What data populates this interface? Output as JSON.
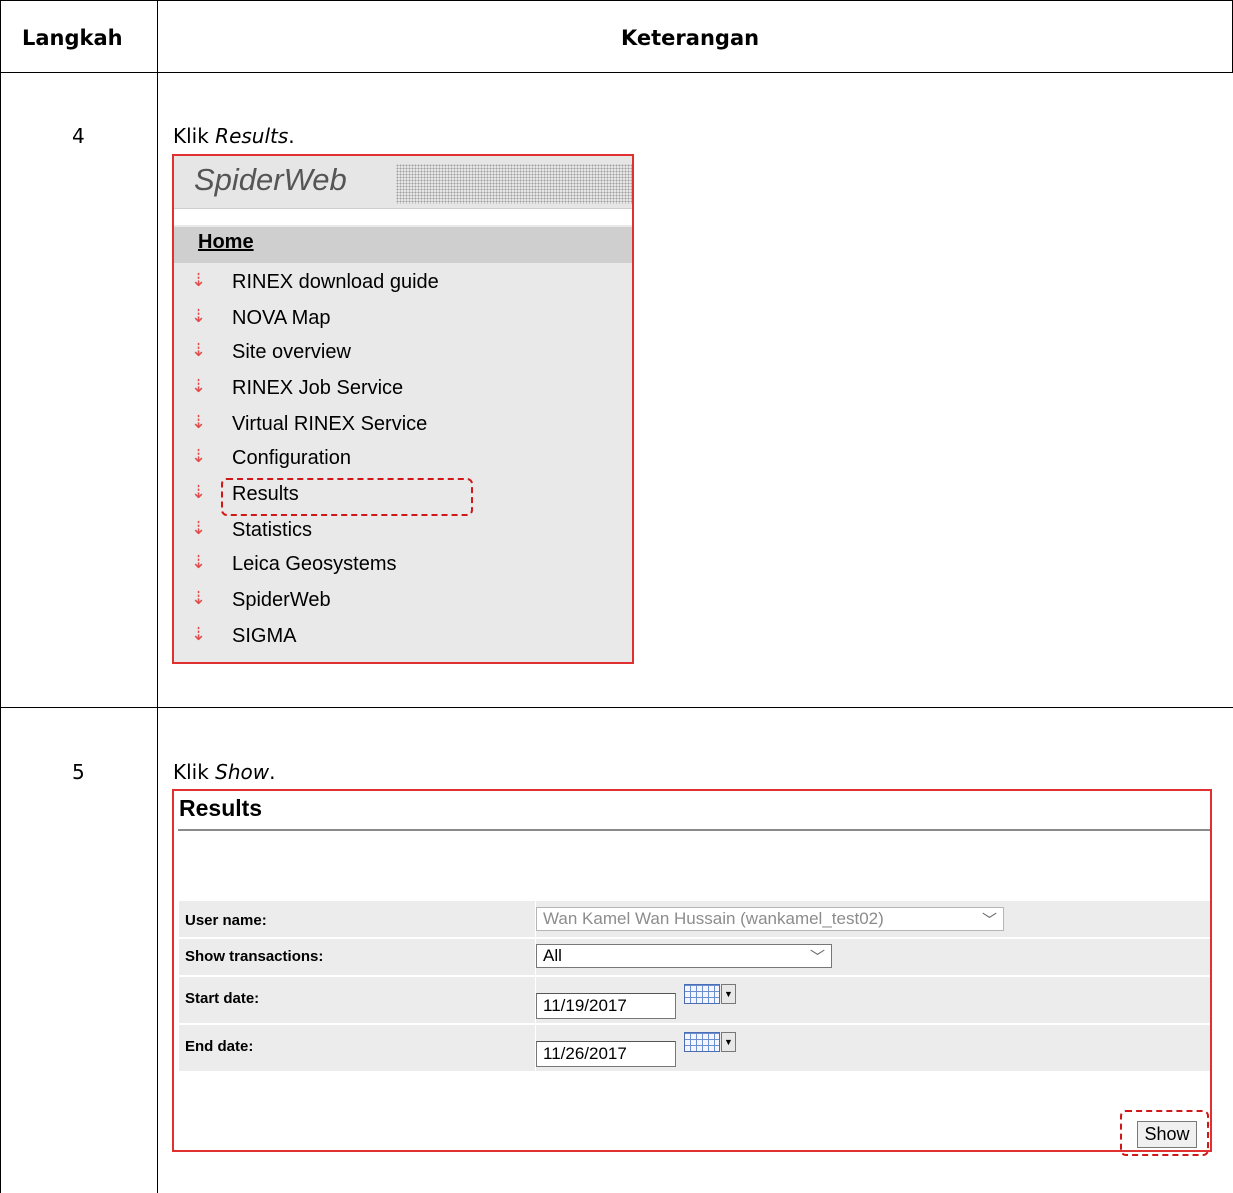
{
  "table": {
    "headers": {
      "step": "Langkah",
      "description": "Keterangan"
    },
    "rows": [
      {
        "step": "4",
        "instruction_prefix": "Klik ",
        "instruction_emphasis": "Results",
        "instruction_suffix": "."
      },
      {
        "step": "5",
        "instruction_prefix": "Klik ",
        "instruction_emphasis": "Show",
        "instruction_suffix": "."
      }
    ]
  },
  "spiderweb": {
    "brand": "SpiderWeb",
    "home": "Home",
    "items": [
      "RINEX download guide",
      "NOVA Map",
      "Site overview",
      "RINEX Job Service",
      "Virtual RINEX Service",
      "Configuration",
      "Results",
      "Statistics",
      "Leica Geosystems",
      "SpiderWeb",
      "SIGMA"
    ],
    "arrow_icon": "⇣",
    "highlighted_item": "Results",
    "accent_color": "#e03030"
  },
  "results": {
    "title": "Results",
    "fields": {
      "user_name": {
        "label": "User name:",
        "value": "Wan Kamel Wan Hussain (wankamel_test02)"
      },
      "show_transactions": {
        "label": "Show transactions:",
        "value": "All"
      },
      "start_date": {
        "label": "Start date:",
        "value": "11/19/2017"
      },
      "end_date": {
        "label": "End date:",
        "value": "11/26/2017"
      }
    },
    "show_button": "Show"
  }
}
